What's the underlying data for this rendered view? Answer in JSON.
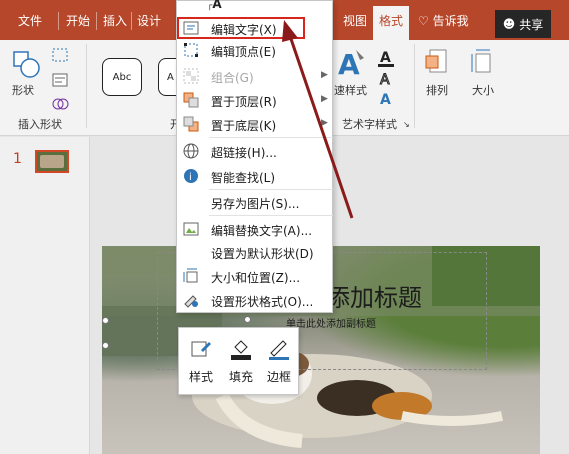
{
  "tabs": {
    "file": "文件",
    "home": "开始",
    "insert": "插入",
    "design": "设计",
    "view": "视图",
    "format": "格式",
    "tell_me": "告诉我",
    "share": "共享"
  },
  "ribbon": {
    "shape_btn": "形状",
    "insert_shape_group": "插入形状",
    "style_sample": "Abc",
    "style_sample_partial": "A",
    "group_label_partial": "开",
    "quick_style": "速样式",
    "art_text_group": "艺术字样式",
    "arrange": "排列",
    "size": "大小"
  },
  "context_menu": {
    "top_glyph": "A",
    "items": [
      {
        "label": "编辑文字(X)",
        "icon": "edit-text-icon",
        "disabled": false,
        "submenu": false
      },
      {
        "label": "编辑顶点(E)",
        "icon": "edit-points-icon",
        "disabled": false,
        "submenu": false
      },
      {
        "label": "组合(G)",
        "icon": "group-icon",
        "disabled": true,
        "submenu": true
      },
      {
        "label": "置于顶层(R)",
        "icon": "bring-front-icon",
        "disabled": false,
        "submenu": true
      },
      {
        "label": "置于底层(K)",
        "icon": "send-back-icon",
        "disabled": false,
        "submenu": true
      },
      {
        "label": "超链接(H)...",
        "icon": "hyperlink-icon",
        "disabled": false,
        "submenu": false
      },
      {
        "label": "智能查找(L)",
        "icon": "smart-lookup-icon",
        "disabled": false,
        "submenu": false
      },
      {
        "label": "另存为图片(S)...",
        "icon": "",
        "disabled": false,
        "submenu": false
      },
      {
        "label": "编辑替换文字(A)...",
        "icon": "alt-text-icon",
        "disabled": false,
        "submenu": false
      },
      {
        "label": "设置为默认形状(D)",
        "icon": "",
        "disabled": false,
        "submenu": false
      },
      {
        "label": "大小和位置(Z)...",
        "icon": "size-position-icon",
        "disabled": false,
        "submenu": false
      },
      {
        "label": "设置形状格式(O)...",
        "icon": "format-shape-icon",
        "disabled": false,
        "submenu": false
      }
    ]
  },
  "mini_toolbar": {
    "style": "样式",
    "fill": "填充",
    "outline": "边框"
  },
  "slides": {
    "number": "1",
    "title_partial": "添加标题",
    "subtitle_partial": "单击此处添加副标题"
  },
  "colors": {
    "accent": "#b7472a",
    "highlight_box": "#d8261c",
    "arrow": "#8b1a1a"
  }
}
